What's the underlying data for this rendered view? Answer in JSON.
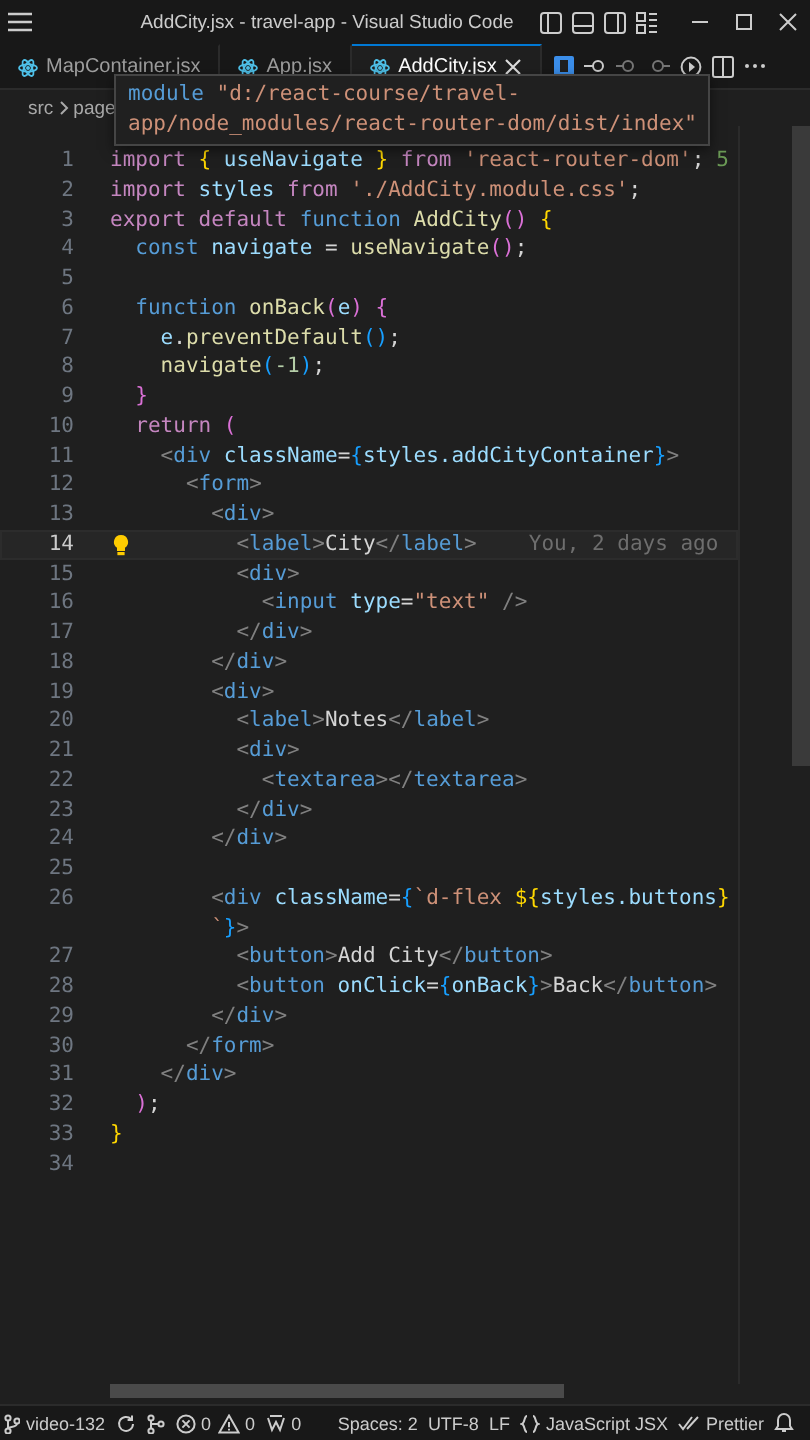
{
  "window": {
    "title": "AddCity.jsx - travel-app - Visual Studio Code"
  },
  "tabs": [
    {
      "label": "MapContainer.jsx",
      "selected": false
    },
    {
      "label": "App.jsx",
      "selected": false
    },
    {
      "label": "AddCity.jsx",
      "selected": true
    }
  ],
  "breadcrumb": [
    "src",
    "page"
  ],
  "hover": {
    "lines": [
      [
        {
          "kind": "st",
          "text": "module"
        },
        {
          "kind": "str",
          "text": " \"d:/react-course/travel-"
        }
      ],
      [
        {
          "kind": "str",
          "text": "app/node_modules/react-router-dom/dist/index\""
        }
      ]
    ]
  },
  "lines": [
    {
      "number": "1",
      "current": false,
      "blame": "5",
      "tokens": [
        {
          "kind": "kw",
          "text": "import"
        },
        {
          "kind": "p1",
          "text": " {"
        },
        {
          "kind": "var",
          "text": " useNavigate"
        },
        {
          "kind": "p1",
          "text": " }"
        },
        {
          "kind": "kw",
          "text": " from"
        },
        {
          "kind": "str",
          "text": " 'react-router-dom'"
        },
        {
          "kind": "tx",
          "text": ";"
        }
      ]
    },
    {
      "number": "2",
      "current": false,
      "tokens": [
        {
          "kind": "kw",
          "text": "import"
        },
        {
          "kind": "var",
          "text": " styles"
        },
        {
          "kind": "kw",
          "text": " from"
        },
        {
          "kind": "str",
          "text": " './AddCity.module.css'"
        },
        {
          "kind": "tx",
          "text": ";"
        }
      ]
    },
    {
      "number": "3",
      "current": false,
      "tokens": [
        {
          "kind": "kw",
          "text": "export default"
        },
        {
          "kind": "st",
          "text": " function"
        },
        {
          "kind": "fn",
          "text": " AddCity"
        },
        {
          "kind": "p2",
          "text": "()"
        },
        {
          "kind": "p1",
          "text": " {"
        }
      ]
    },
    {
      "number": "4",
      "current": false,
      "tokens": [
        {
          "kind": "st",
          "text": "  const"
        },
        {
          "kind": "var",
          "text": " navigate"
        },
        {
          "kind": "tx",
          "text": " ="
        },
        {
          "kind": "fn",
          "text": " useNavigate"
        },
        {
          "kind": "p2",
          "text": "()"
        },
        {
          "kind": "tx",
          "text": ";"
        }
      ]
    },
    {
      "number": "5",
      "current": false
    },
    {
      "number": "6",
      "current": false,
      "tokens": [
        {
          "kind": "st",
          "text": "  function"
        },
        {
          "kind": "fn",
          "text": " onBack"
        },
        {
          "kind": "p2",
          "text": "("
        },
        {
          "kind": "var",
          "text": "e"
        },
        {
          "kind": "p2",
          "text": ")"
        },
        {
          "kind": "p2",
          "text": " {"
        }
      ]
    },
    {
      "number": "7",
      "current": false,
      "tokens": [
        {
          "kind": "var",
          "text": "    e"
        },
        {
          "kind": "tx",
          "text": "."
        },
        {
          "kind": "fn",
          "text": "preventDefault"
        },
        {
          "kind": "p3",
          "text": "()"
        },
        {
          "kind": "tx",
          "text": ";"
        }
      ]
    },
    {
      "number": "8",
      "current": false,
      "tokens": [
        {
          "kind": "fn",
          "text": "    navigate"
        },
        {
          "kind": "p3",
          "text": "("
        },
        {
          "kind": "num",
          "text": "-1"
        },
        {
          "kind": "p3",
          "text": ")"
        },
        {
          "kind": "tx",
          "text": ";"
        }
      ]
    },
    {
      "number": "9",
      "current": false,
      "tokens": [
        {
          "kind": "p2",
          "text": "  }"
        }
      ]
    },
    {
      "number": "10",
      "current": false,
      "tokens": [
        {
          "kind": "kw",
          "text": "  return"
        },
        {
          "kind": "p2",
          "text": " ("
        }
      ]
    },
    {
      "number": "11",
      "current": false,
      "tokens": [
        {
          "kind": "br",
          "text": "    <"
        },
        {
          "kind": "tag",
          "text": "div"
        },
        {
          "kind": "attr",
          "text": " className"
        },
        {
          "kind": "tx",
          "text": "="
        },
        {
          "kind": "p3",
          "text": "{"
        },
        {
          "kind": "var",
          "text": "styles.addCityContainer"
        },
        {
          "kind": "p3",
          "text": "}"
        },
        {
          "kind": "br",
          "text": ">"
        }
      ]
    },
    {
      "number": "12",
      "current": false,
      "tokens": [
        {
          "kind": "br",
          "text": "      <"
        },
        {
          "kind": "tag",
          "text": "form"
        },
        {
          "kind": "br",
          "text": ">"
        }
      ]
    },
    {
      "number": "13",
      "current": false,
      "tokens": [
        {
          "kind": "br",
          "text": "        <"
        },
        {
          "kind": "tag",
          "text": "div"
        },
        {
          "kind": "br",
          "text": ">"
        }
      ]
    },
    {
      "number": "14",
      "current": true,
      "blame": "You, 2 days ago",
      "tokens": [
        {
          "kind": "br",
          "text": "          <"
        },
        {
          "kind": "tag",
          "text": "label"
        },
        {
          "kind": "br",
          "text": ">"
        },
        {
          "kind": "tx",
          "text": "City"
        },
        {
          "kind": "br",
          "text": "</"
        },
        {
          "kind": "tag",
          "text": "label"
        },
        {
          "kind": "br",
          "text": ">"
        }
      ]
    },
    {
      "number": "15",
      "current": false,
      "tokens": [
        {
          "kind": "br",
          "text": "          <"
        },
        {
          "kind": "tag",
          "text": "div"
        },
        {
          "kind": "br",
          "text": ">"
        }
      ]
    },
    {
      "number": "16",
      "current": false,
      "tokens": [
        {
          "kind": "br",
          "text": "            <"
        },
        {
          "kind": "tag",
          "text": "input"
        },
        {
          "kind": "attr",
          "text": " type"
        },
        {
          "kind": "tx",
          "text": "="
        },
        {
          "kind": "str",
          "text": "\"text\""
        },
        {
          "kind": "br",
          "text": " />"
        }
      ]
    },
    {
      "number": "17",
      "current": false,
      "tokens": [
        {
          "kind": "br",
          "text": "          </"
        },
        {
          "kind": "tag",
          "text": "div"
        },
        {
          "kind": "br",
          "text": ">"
        }
      ]
    },
    {
      "number": "18",
      "current": false,
      "tokens": [
        {
          "kind": "br",
          "text": "        </"
        },
        {
          "kind": "tag",
          "text": "div"
        },
        {
          "kind": "br",
          "text": ">"
        }
      ]
    },
    {
      "number": "19",
      "current": false,
      "tokens": [
        {
          "kind": "br",
          "text": "        <"
        },
        {
          "kind": "tag",
          "text": "div"
        },
        {
          "kind": "br",
          "text": ">"
        }
      ]
    },
    {
      "number": "20",
      "current": false,
      "tokens": [
        {
          "kind": "br",
          "text": "          <"
        },
        {
          "kind": "tag",
          "text": "label"
        },
        {
          "kind": "br",
          "text": ">"
        },
        {
          "kind": "tx",
          "text": "Notes"
        },
        {
          "kind": "br",
          "text": "</"
        },
        {
          "kind": "tag",
          "text": "label"
        },
        {
          "kind": "br",
          "text": ">"
        }
      ]
    },
    {
      "number": "21",
      "current": false,
      "tokens": [
        {
          "kind": "br",
          "text": "          <"
        },
        {
          "kind": "tag",
          "text": "div"
        },
        {
          "kind": "br",
          "text": ">"
        }
      ]
    },
    {
      "number": "22",
      "current": false,
      "tokens": [
        {
          "kind": "br",
          "text": "            <"
        },
        {
          "kind": "tag",
          "text": "textarea"
        },
        {
          "kind": "br",
          "text": "></"
        },
        {
          "kind": "tag",
          "text": "textarea"
        },
        {
          "kind": "br",
          "text": ">"
        }
      ]
    },
    {
      "number": "23",
      "current": false,
      "tokens": [
        {
          "kind": "br",
          "text": "          </"
        },
        {
          "kind": "tag",
          "text": "div"
        },
        {
          "kind": "br",
          "text": ">"
        }
      ]
    },
    {
      "number": "24",
      "current": false,
      "tokens": [
        {
          "kind": "br",
          "text": "        </"
        },
        {
          "kind": "tag",
          "text": "div"
        },
        {
          "kind": "br",
          "text": ">"
        }
      ]
    },
    {
      "number": "25",
      "current": false
    },
    {
      "number": "26",
      "current": false,
      "tokens": [
        {
          "kind": "br",
          "text": "        <"
        },
        {
          "kind": "tag",
          "text": "div"
        },
        {
          "kind": "attr",
          "text": " className"
        },
        {
          "kind": "tx",
          "text": "="
        },
        {
          "kind": "p3",
          "text": "{"
        },
        {
          "kind": "str",
          "text": "`d-flex"
        },
        {
          "kind": "p1",
          "text": " ${"
        },
        {
          "kind": "var",
          "text": "styles.buttons"
        },
        {
          "kind": "p1",
          "text": "}"
        }
      ]
    },
    {
      "current": false,
      "tokens": [
        {
          "kind": "str",
          "text": "        `"
        },
        {
          "kind": "p3",
          "text": "}"
        },
        {
          "kind": "br",
          "text": ">"
        }
      ]
    },
    {
      "number": "27",
      "current": false,
      "tokens": [
        {
          "kind": "br",
          "text": "          <"
        },
        {
          "kind": "tag",
          "text": "button"
        },
        {
          "kind": "br",
          "text": ">"
        },
        {
          "kind": "tx",
          "text": "Add City"
        },
        {
          "kind": "br",
          "text": "</"
        },
        {
          "kind": "tag",
          "text": "button"
        },
        {
          "kind": "br",
          "text": ">"
        }
      ]
    },
    {
      "number": "28",
      "current": false,
      "tokens": [
        {
          "kind": "br",
          "text": "          <"
        },
        {
          "kind": "tag",
          "text": "button"
        },
        {
          "kind": "attr",
          "text": " onClick"
        },
        {
          "kind": "tx",
          "text": "="
        },
        {
          "kind": "p3",
          "text": "{"
        },
        {
          "kind": "var",
          "text": "onBack"
        },
        {
          "kind": "p3",
          "text": "}"
        },
        {
          "kind": "br",
          "text": ">"
        },
        {
          "kind": "tx",
          "text": "Back"
        },
        {
          "kind": "br",
          "text": "</"
        },
        {
          "kind": "tag",
          "text": "button"
        },
        {
          "kind": "br",
          "text": ">"
        }
      ]
    },
    {
      "number": "29",
      "current": false,
      "tokens": [
        {
          "kind": "br",
          "text": "        </"
        },
        {
          "kind": "tag",
          "text": "div"
        },
        {
          "kind": "br",
          "text": ">"
        }
      ]
    },
    {
      "number": "30",
      "current": false,
      "tokens": [
        {
          "kind": "br",
          "text": "      </"
        },
        {
          "kind": "tag",
          "text": "form"
        },
        {
          "kind": "br",
          "text": ">"
        }
      ]
    },
    {
      "number": "31",
      "current": false,
      "tokens": [
        {
          "kind": "br",
          "text": "    </"
        },
        {
          "kind": "tag",
          "text": "div"
        },
        {
          "kind": "br",
          "text": ">"
        }
      ]
    },
    {
      "number": "32",
      "current": false,
      "tokens": [
        {
          "kind": "p2",
          "text": "  )"
        },
        {
          "kind": "tx",
          "text": ";"
        }
      ]
    },
    {
      "number": "33",
      "current": false,
      "tokens": [
        {
          "kind": "p1",
          "text": "}"
        }
      ]
    },
    {
      "number": "34",
      "current": false
    }
  ],
  "status_bar": {
    "branch": "video-132",
    "errors": "0",
    "warnings": "0",
    "ports": "0",
    "indentation": "Spaces: 2",
    "encoding": "UTF-8",
    "eol": "LF",
    "language": "JavaScript JSX",
    "formatter": "Prettier"
  }
}
